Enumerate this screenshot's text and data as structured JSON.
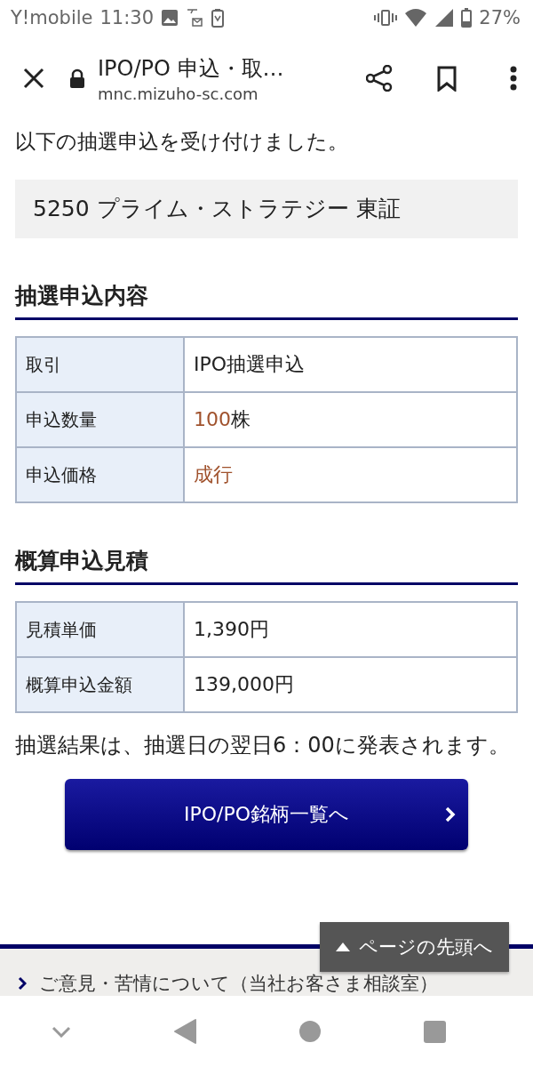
{
  "status_bar": {
    "carrier": "Y!mobile",
    "time": "11:30",
    "battery": "27%"
  },
  "toolbar": {
    "title": "IPO/PO 申込・取…",
    "url": "mnc.mizuho-sc.com"
  },
  "message": "以下の抽選申込を受け付けました。",
  "stock": "5250 プライム・ストラテジー 東証",
  "sections": [
    {
      "heading": "抽選申込内容",
      "rows": [
        {
          "label": "取引",
          "value": "IPO抽選申込",
          "emphasis": false
        },
        {
          "label": "申込数量",
          "value": "100",
          "unit": "株",
          "emphasis": true
        },
        {
          "label": "申込価格",
          "value": "成行",
          "emphasis": true
        }
      ]
    },
    {
      "heading": "概算申込見積",
      "rows": [
        {
          "label": "見積単価",
          "value": "1,390円",
          "emphasis": false
        },
        {
          "label": "概算申込金額",
          "value": "139,000円",
          "emphasis": false
        }
      ]
    }
  ],
  "note": "抽選結果は、抽選日の翌日6：00に発表されます。",
  "primary_button": "IPO/PO銘柄一覧へ",
  "back_to_top": "ページの先頭へ",
  "footer_link": "ご意見・苦情について（当社お客さま相談室）"
}
